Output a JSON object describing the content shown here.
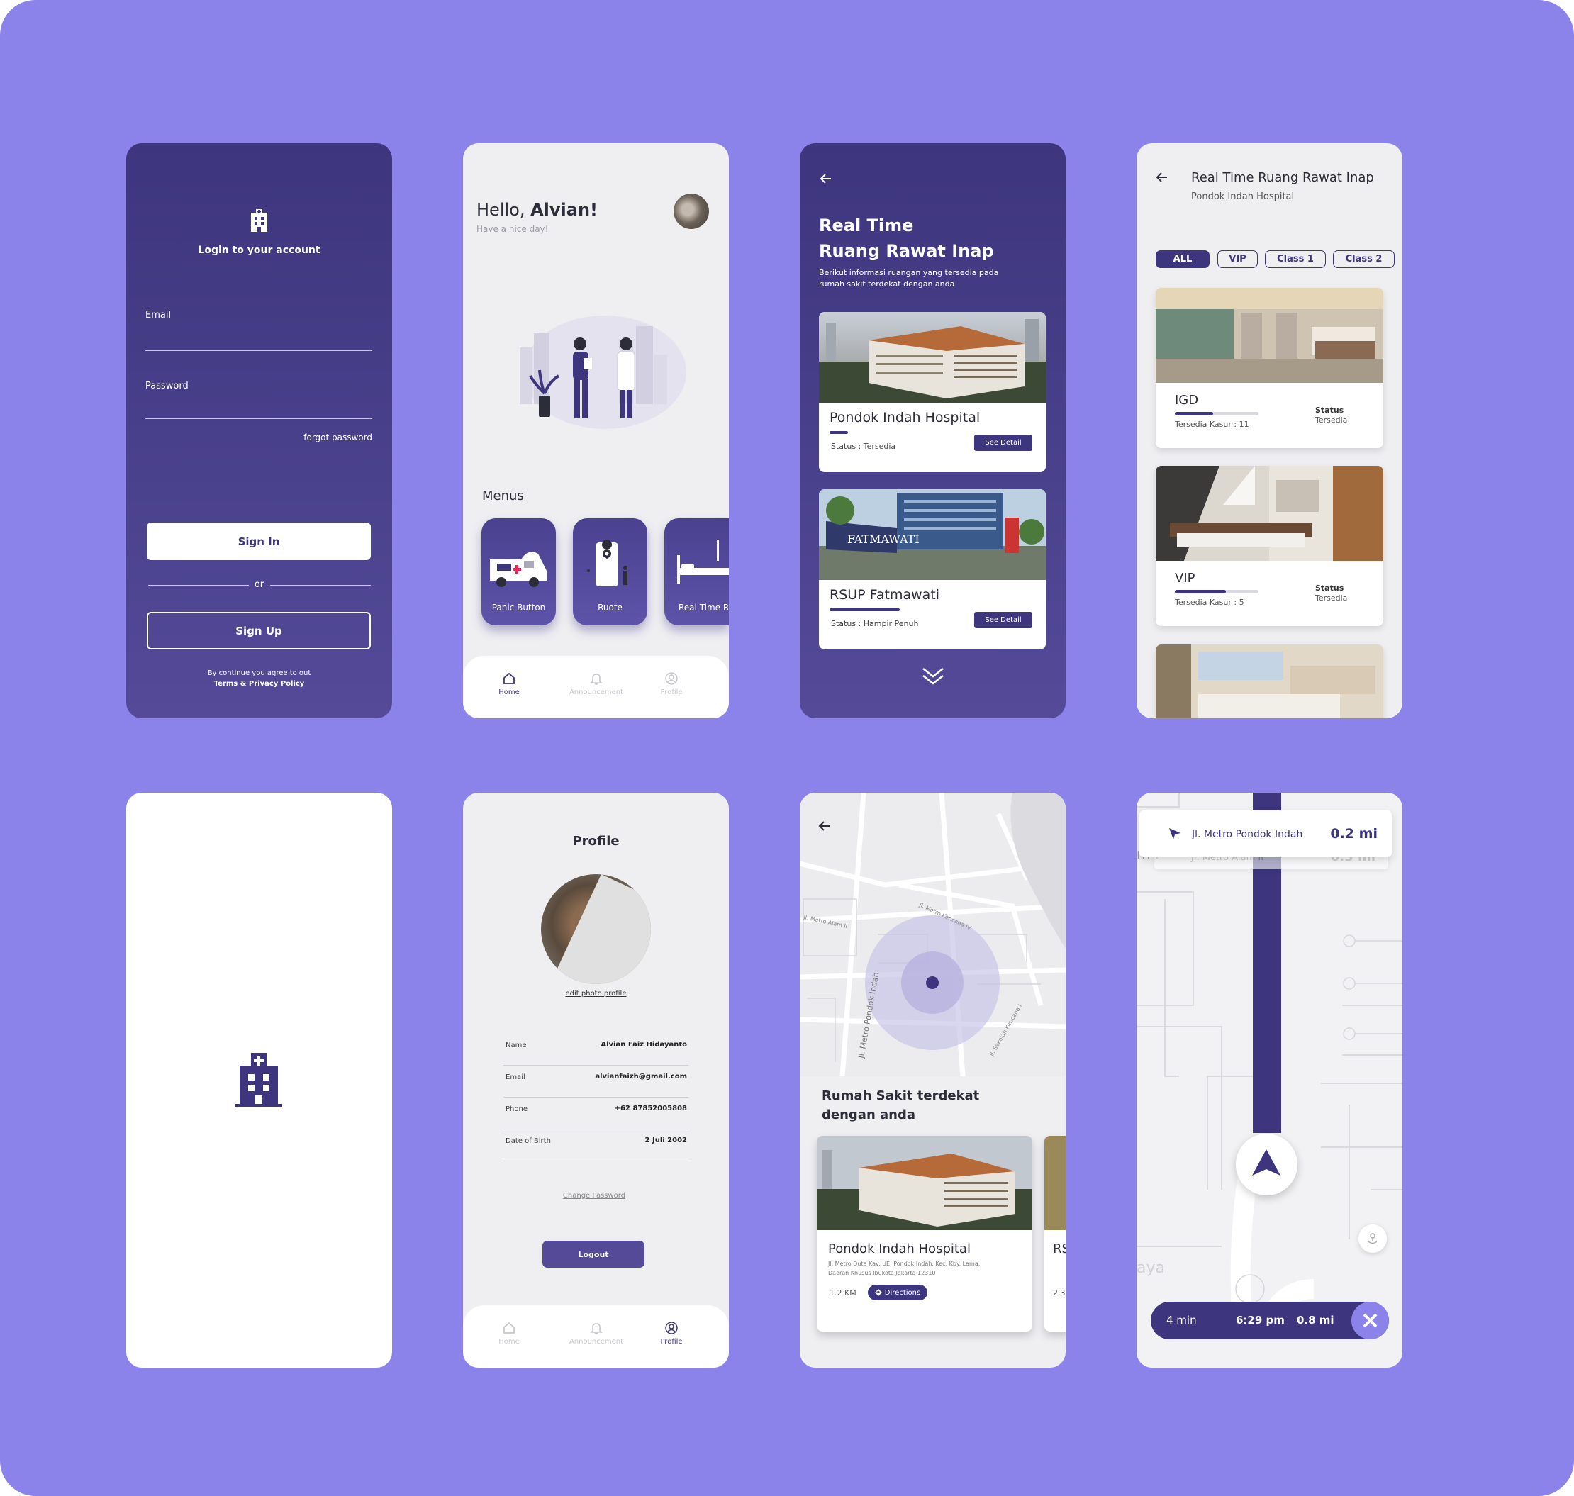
{
  "colors": {
    "background": "#8b82ea",
    "primary": "#3d357d",
    "primary_light": "#544a98"
  },
  "login": {
    "title": "Login to your account",
    "email_label": "Email",
    "password_label": "Password",
    "forgot_password": "forgot password",
    "sign_in": "Sign In",
    "or": "or",
    "sign_up": "Sign Up",
    "terms_prefix": "By continue you agree to out",
    "terms_link": "Terms & Privacy Policy",
    "icon": "hospital-icon"
  },
  "home": {
    "greeting": "Hello, ",
    "name": "Alvian!",
    "subtitle": "Have a nice day!",
    "menus_title": "Menus",
    "menus": [
      {
        "label": "Panic Button",
        "icon": "ambulance-icon"
      },
      {
        "label": "Ruote",
        "icon": "map-pin-icon"
      },
      {
        "label": "Real Time R",
        "icon": "hospital-bed-icon"
      }
    ],
    "nav": [
      {
        "label": "Home",
        "icon": "home-icon",
        "active": true
      },
      {
        "label": "Announcement",
        "icon": "bell-icon"
      },
      {
        "label": "Profile",
        "icon": "user-icon"
      }
    ]
  },
  "realtime": {
    "title_line1": "Real Time",
    "title_line2": "Ruang Rawat Inap",
    "desc_line1": "Berikut informasi ruangan yang tersedia pada",
    "desc_line2": "rumah sakit terdekat dengan anda",
    "hospitals": [
      {
        "name": "Pondok Indah Hospital",
        "status": "Status : Tersedia",
        "button": "See Detail",
        "fill": 0.12
      },
      {
        "name": "RSUP Fatmawati",
        "status": "Status : Hampir Penuh",
        "button": "See Detail",
        "fill": 0.45
      }
    ]
  },
  "rooms": {
    "title": "Real Time Ruang Rawat Inap",
    "subtitle": "Pondok Indah Hospital",
    "filters": [
      "ALL",
      "VIP",
      "Class 1",
      "Class 2"
    ],
    "cards": [
      {
        "name": "IGD",
        "kasur": "Tersedia Kasur : 11",
        "status_label": "Status",
        "status": "Tersedia",
        "fill": 0.33
      },
      {
        "name": "VIP",
        "kasur": "Tersedia Kasur : 5",
        "status_label": "Status",
        "status": "Tersedia",
        "fill": 0.44
      }
    ]
  },
  "splash": {
    "icon": "hospital-icon"
  },
  "profile": {
    "title": "Profile",
    "edit_photo": "edit photo profile",
    "rows": [
      {
        "label": "Name",
        "value": "Alvian Faiz Hidayanto"
      },
      {
        "label": "Email",
        "value": "alvianfaizh@gmail.com"
      },
      {
        "label": "Phone",
        "value": "+62 87852005808"
      },
      {
        "label": "Date of Birth",
        "value": "2 Juli 2002"
      }
    ],
    "change_password": "Change Password",
    "logout": "Logout",
    "nav": [
      {
        "label": "Home",
        "icon": "home-icon"
      },
      {
        "label": "Announcement",
        "icon": "bell-icon"
      },
      {
        "label": "Profile",
        "icon": "user-icon",
        "active": true
      }
    ]
  },
  "map": {
    "street_labels": [
      "Jl. Metro Alam II",
      "Jl. Metro Kencana IV",
      "Jl. Metro Pondok Indah",
      "Jl. Sekolah Kencana I",
      "Jl. Metro Alam II"
    ],
    "heading_line1": "Rumah Sakit terdekat",
    "heading_line2": "dengan anda",
    "card": {
      "name": "Pondok Indah Hospital",
      "address_line1": "Jl. Metro Duta Kav. UE, Pondok Indah, Kec. Kby. Lama,",
      "address_line2": "Daerah Khusus Ibukota Jakarta 12310",
      "distance": "1.2 KM",
      "button": "Directions"
    },
    "card2": {
      "name_partial": "RS",
      "distance_partial": "2.3"
    }
  },
  "navigation": {
    "current_street": "Jl. Metro Pondok Indah",
    "current_dist": "0.2 mi",
    "next_street": "Jl. Metro Alam II",
    "next_dist": "0.3 mi",
    "bg_text1": "m I",
    "bg_text2": "aya",
    "eta_time": "4 min",
    "arrival": "6:29 pm",
    "distance": "0.8 mi"
  }
}
